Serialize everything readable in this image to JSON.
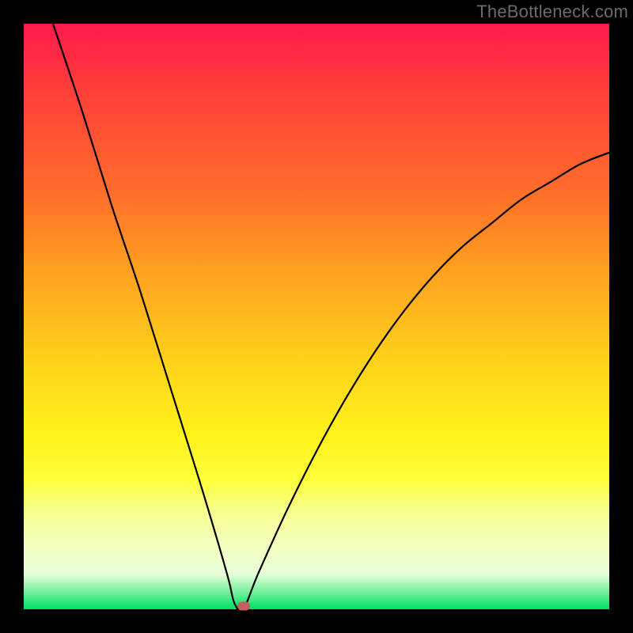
{
  "watermark": "TheBottleneck.com",
  "chart_data": {
    "type": "line",
    "title": "",
    "xlabel": "",
    "ylabel": "",
    "xlim": [
      0,
      100
    ],
    "ylim": [
      0,
      100
    ],
    "series": [
      {
        "name": "curve",
        "x": [
          5,
          10,
          15,
          20,
          25,
          30,
          33,
          35,
          36,
          37.5,
          40,
          45,
          50,
          55,
          60,
          65,
          70,
          75,
          80,
          85,
          90,
          95,
          100
        ],
        "y": [
          100,
          85,
          69,
          54,
          38,
          22,
          12,
          5,
          1,
          0,
          6,
          17,
          27,
          36,
          44,
          51,
          57,
          62,
          66,
          70,
          73,
          76,
          78
        ]
      }
    ],
    "marker": {
      "x": 37.5,
      "y": 0
    }
  }
}
